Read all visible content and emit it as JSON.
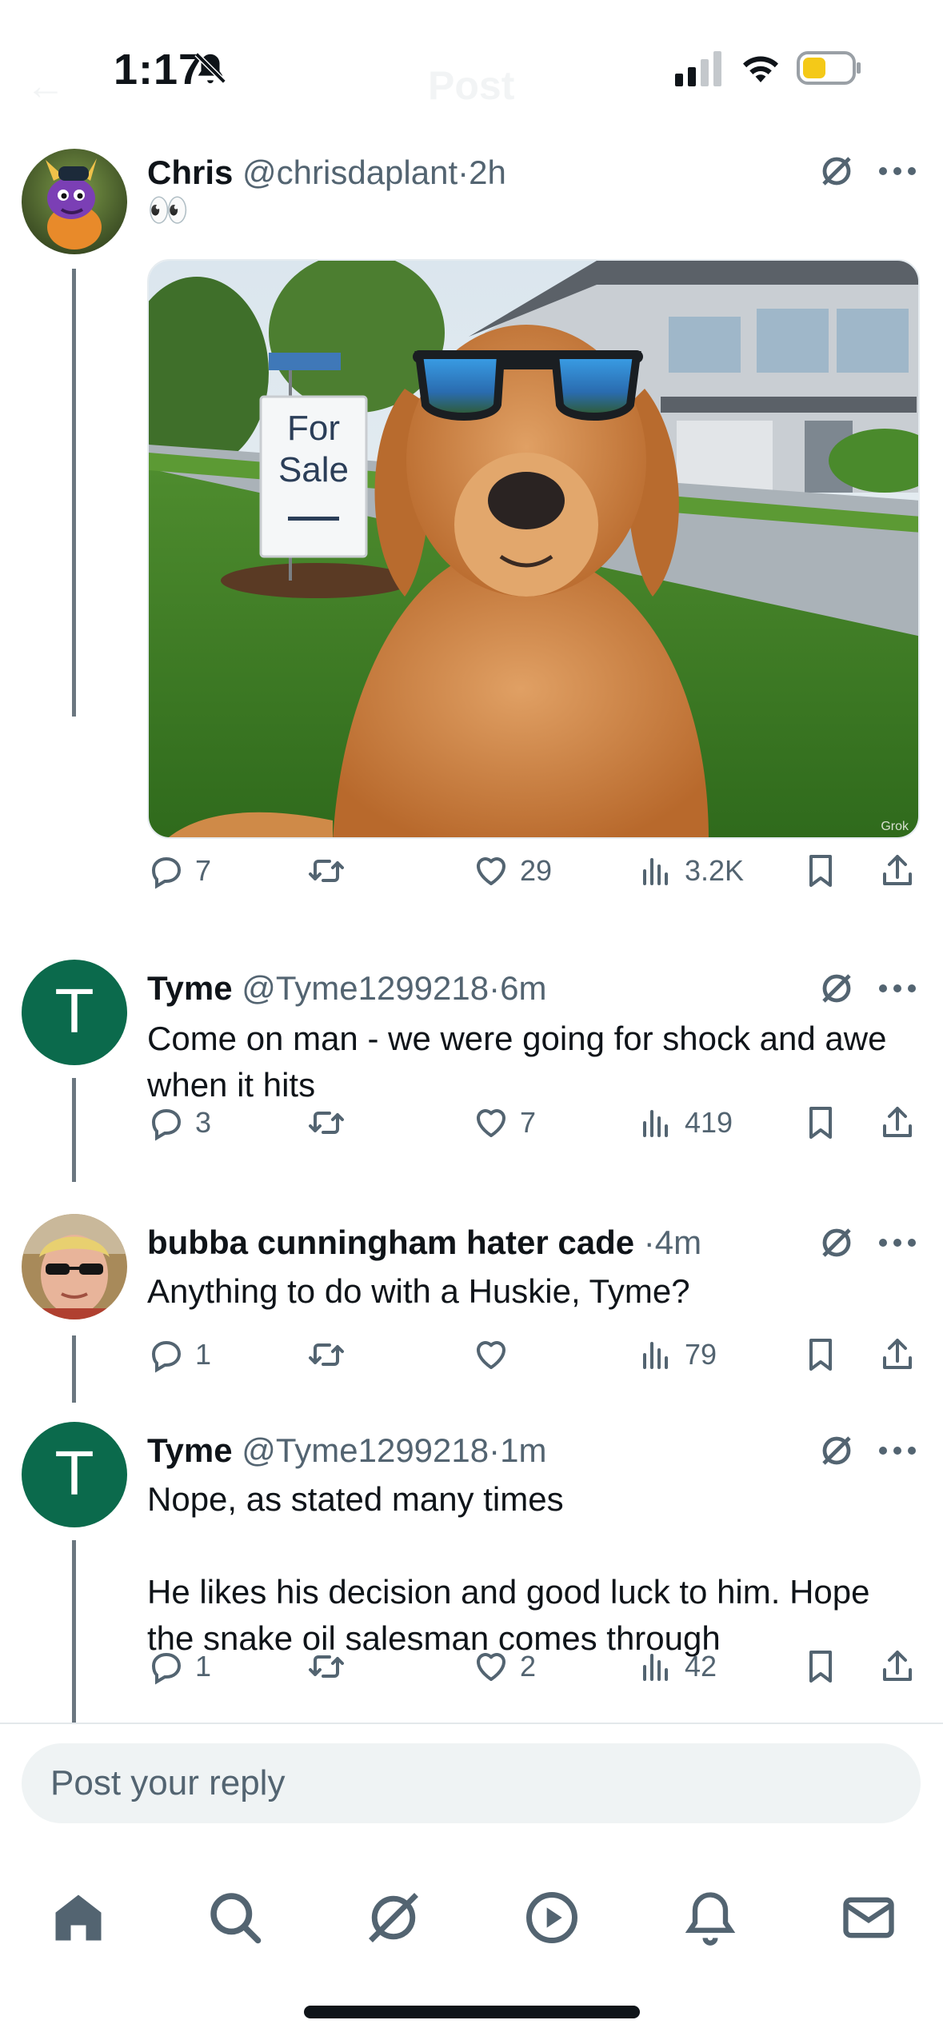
{
  "status_bar": {
    "time": "1:17",
    "ghost_left": "←",
    "ghost_title": "Post"
  },
  "posts": [
    {
      "name": "Chris",
      "handle": "@chrisdaplant",
      "sep": "·",
      "time": "2h",
      "text": "👀",
      "media_watermark": "Grok",
      "sign_text_1": "For",
      "sign_text_2": "Sale",
      "replies": "7",
      "reposts": "",
      "likes": "29",
      "views": "3.2K"
    },
    {
      "name": "Tyme",
      "handle": "@Tyme1299218",
      "sep": "·",
      "time": "6m",
      "avatar_letter": "T",
      "text": "Come on man - we were going for shock and awe when it hits",
      "replies": "3",
      "reposts": "",
      "likes": "7",
      "views": "419"
    },
    {
      "name": "bubba cunningham hater cade",
      "handle": "",
      "sep": "·",
      "time": "4m",
      "text": "Anything to do with a Huskie, Tyme?",
      "replies": "1",
      "reposts": "",
      "likes": "",
      "views": "79"
    },
    {
      "name": "Tyme",
      "handle": "@Tyme1299218",
      "sep": "·",
      "time": "1m",
      "avatar_letter": "T",
      "text": "Nope, as stated many times\n\nHe likes his decision and good luck to him. Hope the snake oil salesman comes through",
      "replies": "1",
      "reposts": "",
      "likes": "2",
      "views": "42"
    }
  ],
  "reply_box": {
    "placeholder": "Post your reply"
  },
  "tabs": [
    "home-icon",
    "search-icon",
    "grok-icon",
    "play-icon",
    "bell-icon",
    "mail-icon"
  ],
  "colors": {
    "brand_green": "#0b6a4c",
    "muted": "#536471",
    "text": "#0f1419"
  }
}
